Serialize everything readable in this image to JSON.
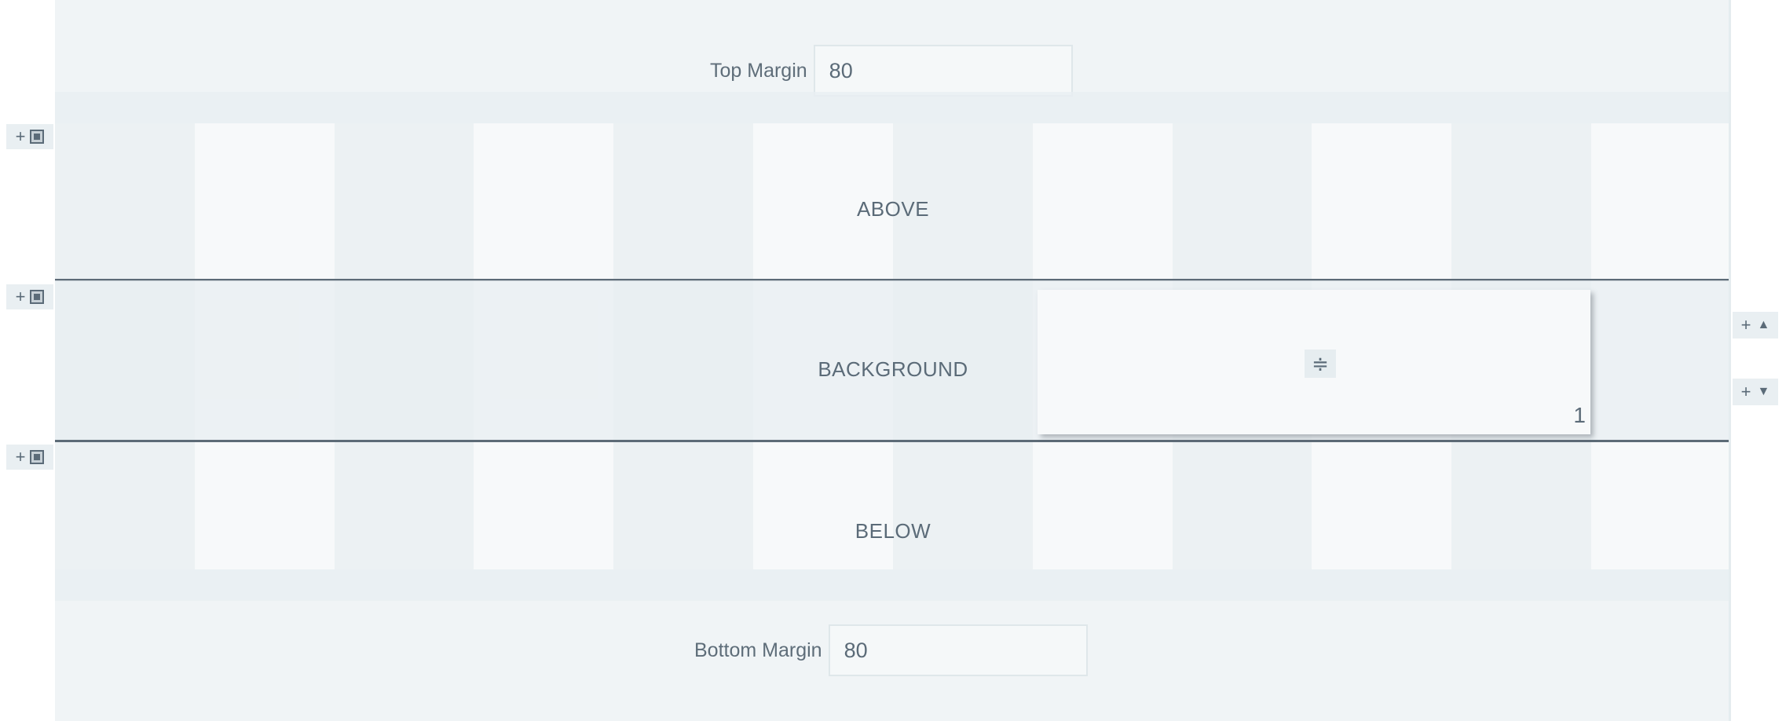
{
  "top_margin": {
    "label": "Top Margin",
    "value": "80"
  },
  "bottom_margin": {
    "label": "Bottom Margin",
    "value": "80"
  },
  "layers": {
    "above": "ABOVE",
    "background": "BACKGROUND",
    "below": "BELOW"
  },
  "block": {
    "align_icon": "≑",
    "number": "1"
  },
  "side_controls": {
    "plus": "+"
  },
  "right_controls": {
    "plus": "+",
    "up_arrow": "▲",
    "down_arrow": "▼"
  },
  "icons": [
    "add-layer-icon",
    "layer-square-icon",
    "align-icon",
    "move-up-icon",
    "move-down-icon"
  ],
  "colors": {
    "divider": "#5d6b77",
    "text": "#5b6b78",
    "canvas": "#f1f5f6"
  }
}
